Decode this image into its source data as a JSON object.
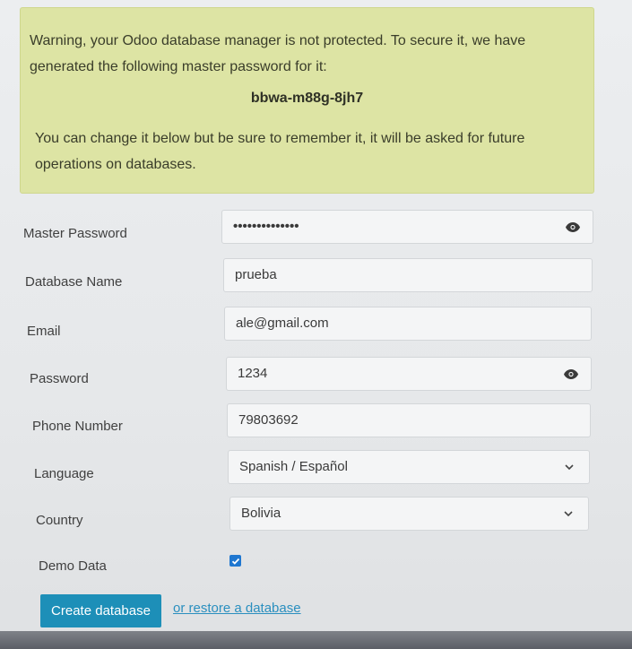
{
  "warning": {
    "line1": "Warning, your Odoo database manager is not protected. To secure it, we have",
    "line2": "generated the following master password for it:",
    "master_password": "bbwa-m88g-8jh7",
    "line3": "You can change it below but be sure to remember it, it will be asked for future",
    "line4": "operations on databases."
  },
  "form": {
    "master_password": {
      "label": "Master Password",
      "value": "••••••••••••••"
    },
    "database_name": {
      "label": "Database Name",
      "value": "prueba"
    },
    "email": {
      "label": "Email",
      "value": "ale@gmail.com"
    },
    "password": {
      "label": "Password",
      "value": "1234"
    },
    "phone": {
      "label": "Phone Number",
      "value": "79803692"
    },
    "language": {
      "label": "Language",
      "value": "Spanish / Español"
    },
    "country": {
      "label": "Country",
      "value": "Bolivia"
    },
    "demo_data": {
      "label": "Demo Data",
      "checked": true
    }
  },
  "actions": {
    "create_label": "Create database",
    "restore_label": "or restore a database"
  },
  "colors": {
    "warning_bg": "#dde4a4",
    "primary": "#1d8fb8",
    "link": "#2a8fbf",
    "checkbox": "#1f77d0"
  },
  "icons": {
    "eye": "eye-icon",
    "chevron": "chevron-down-icon",
    "check": "check-icon"
  }
}
